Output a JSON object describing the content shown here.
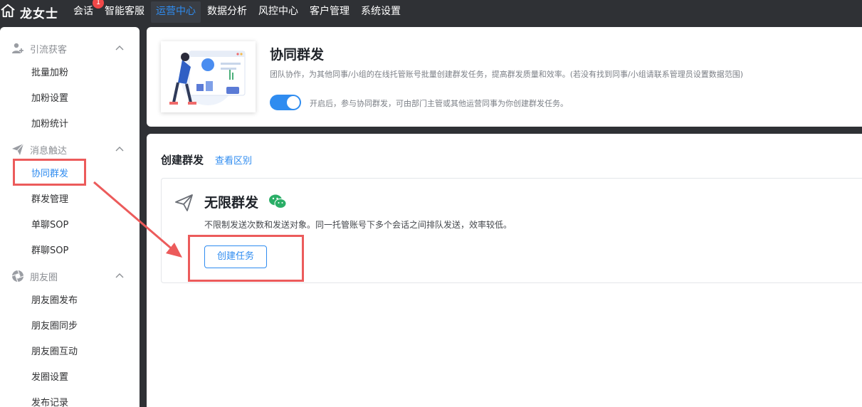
{
  "nav": {
    "brand": "龙女士",
    "items": [
      {
        "label": "会话",
        "badge": "1"
      },
      {
        "label": "智能客服"
      },
      {
        "label": "运营中心"
      },
      {
        "label": "数据分析"
      },
      {
        "label": "风控中心"
      },
      {
        "label": "客户管理"
      },
      {
        "label": "系统设置"
      }
    ],
    "active": "运营中心"
  },
  "sidebar": {
    "groups": [
      {
        "label": "引流获客",
        "icon": "user-add-icon",
        "items": [
          "批量加粉",
          "加粉设置",
          "加粉统计"
        ]
      },
      {
        "label": "消息触达",
        "icon": "paper-plane-icon",
        "items": [
          "协同群发",
          "群发管理",
          "单聊SOP",
          "群聊SOP"
        ]
      },
      {
        "label": "朋友圈",
        "icon": "camera-shutter-icon",
        "items": [
          "朋友圈发布",
          "朋友圈同步",
          "朋友圈互动",
          "发圈设置",
          "发布记录"
        ]
      }
    ],
    "active_item": "协同群发"
  },
  "header": {
    "title": "协同群发",
    "description": "团队协作，为其他同事/小组的在线托管账号批量创建群发任务，提高群发质量和效率。(若没有找到同事/小组请联系管理员设置数据范围)",
    "toggle_on": true,
    "toggle_text": "开启后，参与协同群发，可由部门主管或其他运营同事为你创建群发任务。"
  },
  "section": {
    "title": "创建群发",
    "link": "查看区别",
    "card": {
      "title": "无限群发",
      "description": "不限制发送次数和发送对象。同一托管账号下多个会话之间排队发送，效率较低。",
      "button": "创建任务"
    }
  },
  "colors": {
    "accent": "#2f8cf0",
    "nav_bg": "#2f3135",
    "annotation": "#ec5b5b",
    "wechat": "#2aae67"
  }
}
